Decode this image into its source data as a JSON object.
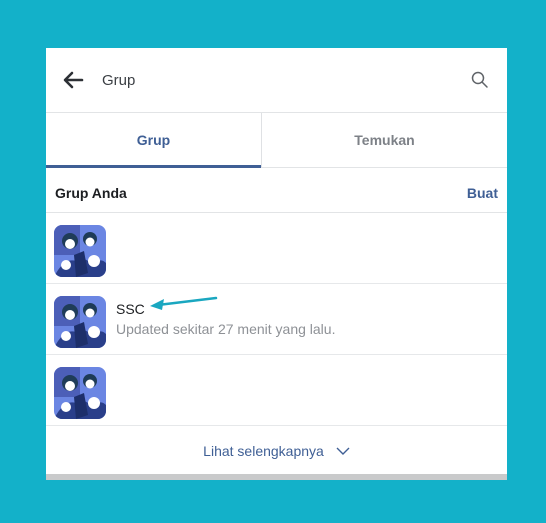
{
  "header": {
    "title": "Grup",
    "back_icon": "arrow-left-icon",
    "search_icon": "search-icon"
  },
  "tabs": [
    {
      "label": "Grup",
      "active": true
    },
    {
      "label": "Temukan",
      "active": false
    }
  ],
  "section": {
    "title": "Grup Anda",
    "action": "Buat"
  },
  "groups": [
    {
      "name": "",
      "subtitle": ""
    },
    {
      "name": "SSC",
      "subtitle": "Updated sekitar 27 menit yang lalu."
    },
    {
      "name": "",
      "subtitle": ""
    }
  ],
  "footer": {
    "label": "Lihat selengkapnya",
    "icon": "chevron-down-icon"
  },
  "colors": {
    "background": "#13b1c9",
    "accent": "#3f5f95",
    "annotation_arrow": "#1aa7c0"
  }
}
